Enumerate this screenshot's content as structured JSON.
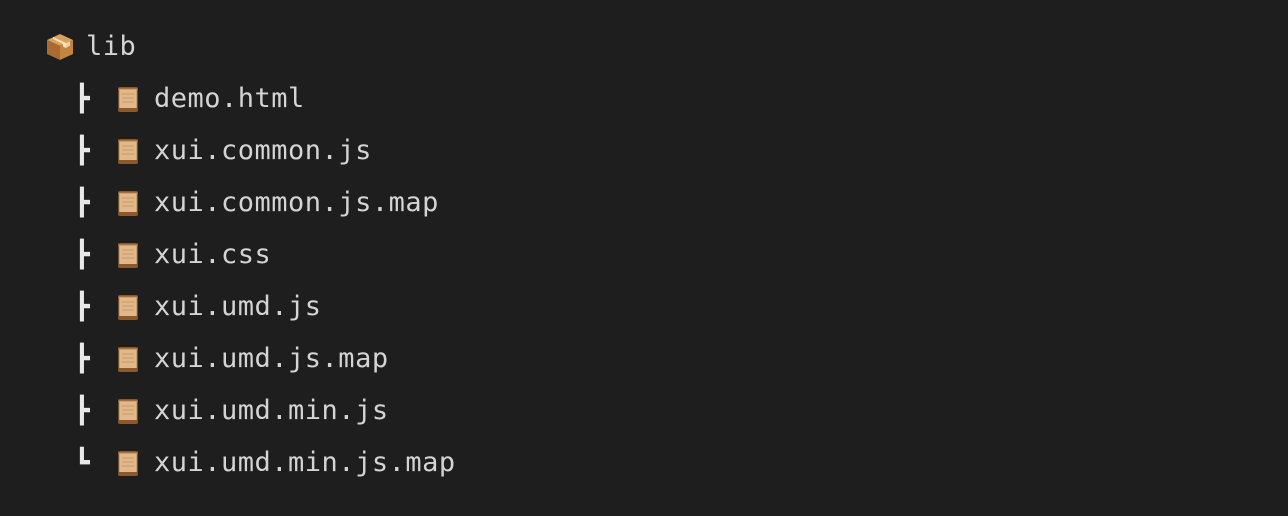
{
  "root": {
    "name": "lib",
    "icon": "package-icon"
  },
  "children": [
    {
      "branch": "┣",
      "name": "demo.html",
      "icon": "scroll-icon"
    },
    {
      "branch": "┣",
      "name": "xui.common.js",
      "icon": "scroll-icon"
    },
    {
      "branch": "┣",
      "name": "xui.common.js.map",
      "icon": "scroll-icon"
    },
    {
      "branch": "┣",
      "name": "xui.css",
      "icon": "scroll-icon"
    },
    {
      "branch": "┣",
      "name": "xui.umd.js",
      "icon": "scroll-icon"
    },
    {
      "branch": "┣",
      "name": "xui.umd.js.map",
      "icon": "scroll-icon"
    },
    {
      "branch": "┣",
      "name": "xui.umd.min.js",
      "icon": "scroll-icon"
    },
    {
      "branch": "┗",
      "name": "xui.umd.min.js.map",
      "icon": "scroll-icon"
    }
  ],
  "colors": {
    "background": "#1e1e1e",
    "text": "#d4d4d4"
  }
}
